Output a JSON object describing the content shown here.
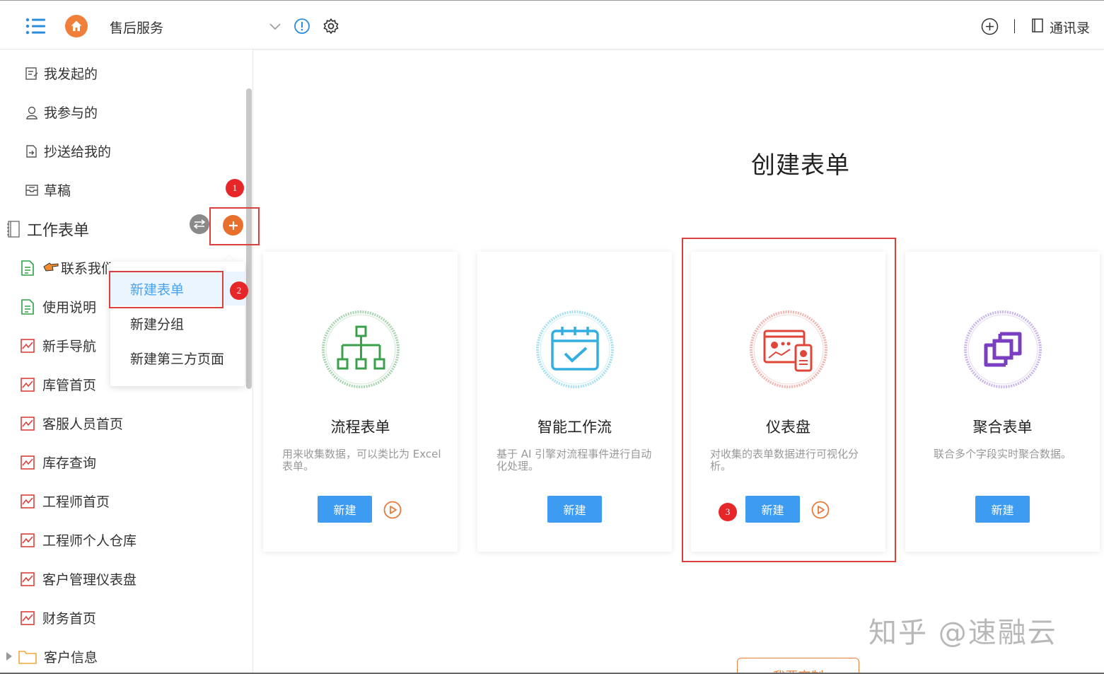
{
  "header": {
    "title": "售后服务",
    "contacts_label": "通讯录"
  },
  "sidebar": {
    "top_items": [
      {
        "label": "我发起的",
        "icon": "edit-doc-icon"
      },
      {
        "label": "我参与的",
        "icon": "user-icon"
      },
      {
        "label": "抄送给我的",
        "icon": "forward-doc-icon"
      },
      {
        "label": "草稿",
        "icon": "draft-box-icon"
      }
    ],
    "group_title": "工作表单",
    "items": [
      {
        "label": "联系我们",
        "icon": "form-doc-icon"
      },
      {
        "label": "使用说明",
        "icon": "form-doc-icon"
      },
      {
        "label": "新手导航",
        "icon": "chart-icon"
      },
      {
        "label": "库管首页",
        "icon": "chart-icon"
      },
      {
        "label": "客服人员首页",
        "icon": "chart-icon"
      },
      {
        "label": "库存查询",
        "icon": "chart-icon"
      },
      {
        "label": "工程师首页",
        "icon": "chart-icon"
      },
      {
        "label": "工程师个人仓库",
        "icon": "chart-icon"
      },
      {
        "label": "客户管理仪表盘",
        "icon": "chart-icon"
      },
      {
        "label": "财务首页",
        "icon": "chart-icon"
      }
    ],
    "folder": {
      "label": "客户信息",
      "icon": "folder-icon"
    }
  },
  "dropdown": {
    "items": [
      "新建表单",
      "新建分组",
      "新建第三方页面"
    ]
  },
  "badges": [
    "1",
    "2",
    "3"
  ],
  "main": {
    "title": "创建表单",
    "cards": [
      {
        "title": "流程表单",
        "desc": "用来收集数据，可以类比为 Excel 表单。",
        "button": "新建",
        "color": "#3aa04b"
      },
      {
        "title": "智能工作流",
        "desc": "基于 AI 引擎对流程事件进行自动化处理。",
        "button": "新建",
        "color": "#33aee0"
      },
      {
        "title": "仪表盘",
        "desc": "对收集的表单数据进行可视化分析。",
        "button": "新建",
        "color": "#e0453a"
      },
      {
        "title": "聚合表单",
        "desc": "联合多个字段实时聚合数据。",
        "button": "新建",
        "color": "#7a3fc0"
      }
    ],
    "bottom_button": "我要定制"
  },
  "watermark": "知乎 @速融云",
  "colors": {
    "accent": "#3d9cf1",
    "home": "#f07f3a",
    "badge": "#e7262a",
    "highlight_box": "#d94040"
  }
}
